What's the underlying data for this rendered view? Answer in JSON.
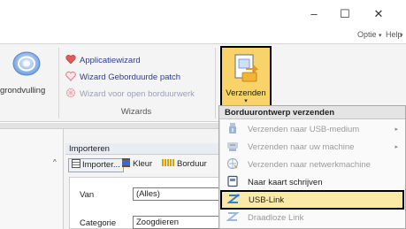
{
  "window": {
    "controls": {
      "minimize": "–",
      "maximize": "☐",
      "close": "✕"
    }
  },
  "ribbon": {
    "right_tabs": {
      "optie": "Optie",
      "help": "Help",
      "caret": "▾"
    },
    "left_partial_label": "grondvulling",
    "wizards": {
      "items": [
        {
          "label": "Applicatiewizard",
          "enabled": true,
          "icon": "heart-icon"
        },
        {
          "label": "Wizard Geborduurde patch",
          "enabled": true,
          "icon": "heart-outline-icon"
        },
        {
          "label": "Wizard voor open borduurwerk",
          "enabled": false,
          "icon": "lace-icon"
        }
      ],
      "group_label": "Wizards"
    },
    "verzenden": {
      "label": "Verzenden",
      "arrow": "▾",
      "icon": "send-design-icon"
    }
  },
  "importeren": {
    "title": "Importeren",
    "tools": {
      "importer": "Importer...",
      "kleur": "Kleur",
      "borduur": "Borduur"
    },
    "form": {
      "van_label": "Van",
      "van_value": "(Alles)",
      "categorie_label": "Categorie",
      "categorie_value": "Zoogdieren"
    }
  },
  "menu": {
    "title": "Borduurontwerp verzenden",
    "items": [
      {
        "label": "Verzenden naar USB-medium",
        "enabled": false,
        "submenu": true,
        "icon": "usb-drive-icon"
      },
      {
        "label": "Verzenden naar uw machine",
        "enabled": false,
        "submenu": true,
        "icon": "machine-icon"
      },
      {
        "label": "Verzenden naar netwerkmachine",
        "enabled": false,
        "submenu": false,
        "icon": "network-icon"
      },
      {
        "label": "Naar kaart schrijven",
        "enabled": true,
        "submenu": false,
        "icon": "card-icon"
      },
      {
        "label": "USB-Link",
        "enabled": true,
        "submenu": false,
        "icon": "usb-link-icon",
        "highlighted": true
      },
      {
        "label": "Draadloze Link",
        "enabled": false,
        "submenu": false,
        "icon": "wireless-link-icon"
      }
    ],
    "submenu_arrow": "▸"
  },
  "colors": {
    "accent_highlight": "#fbe9a8",
    "button_highlight": "#f7d36a",
    "wizard_text": "#2b3f8a",
    "disabled_text": "#9a9a9a"
  }
}
